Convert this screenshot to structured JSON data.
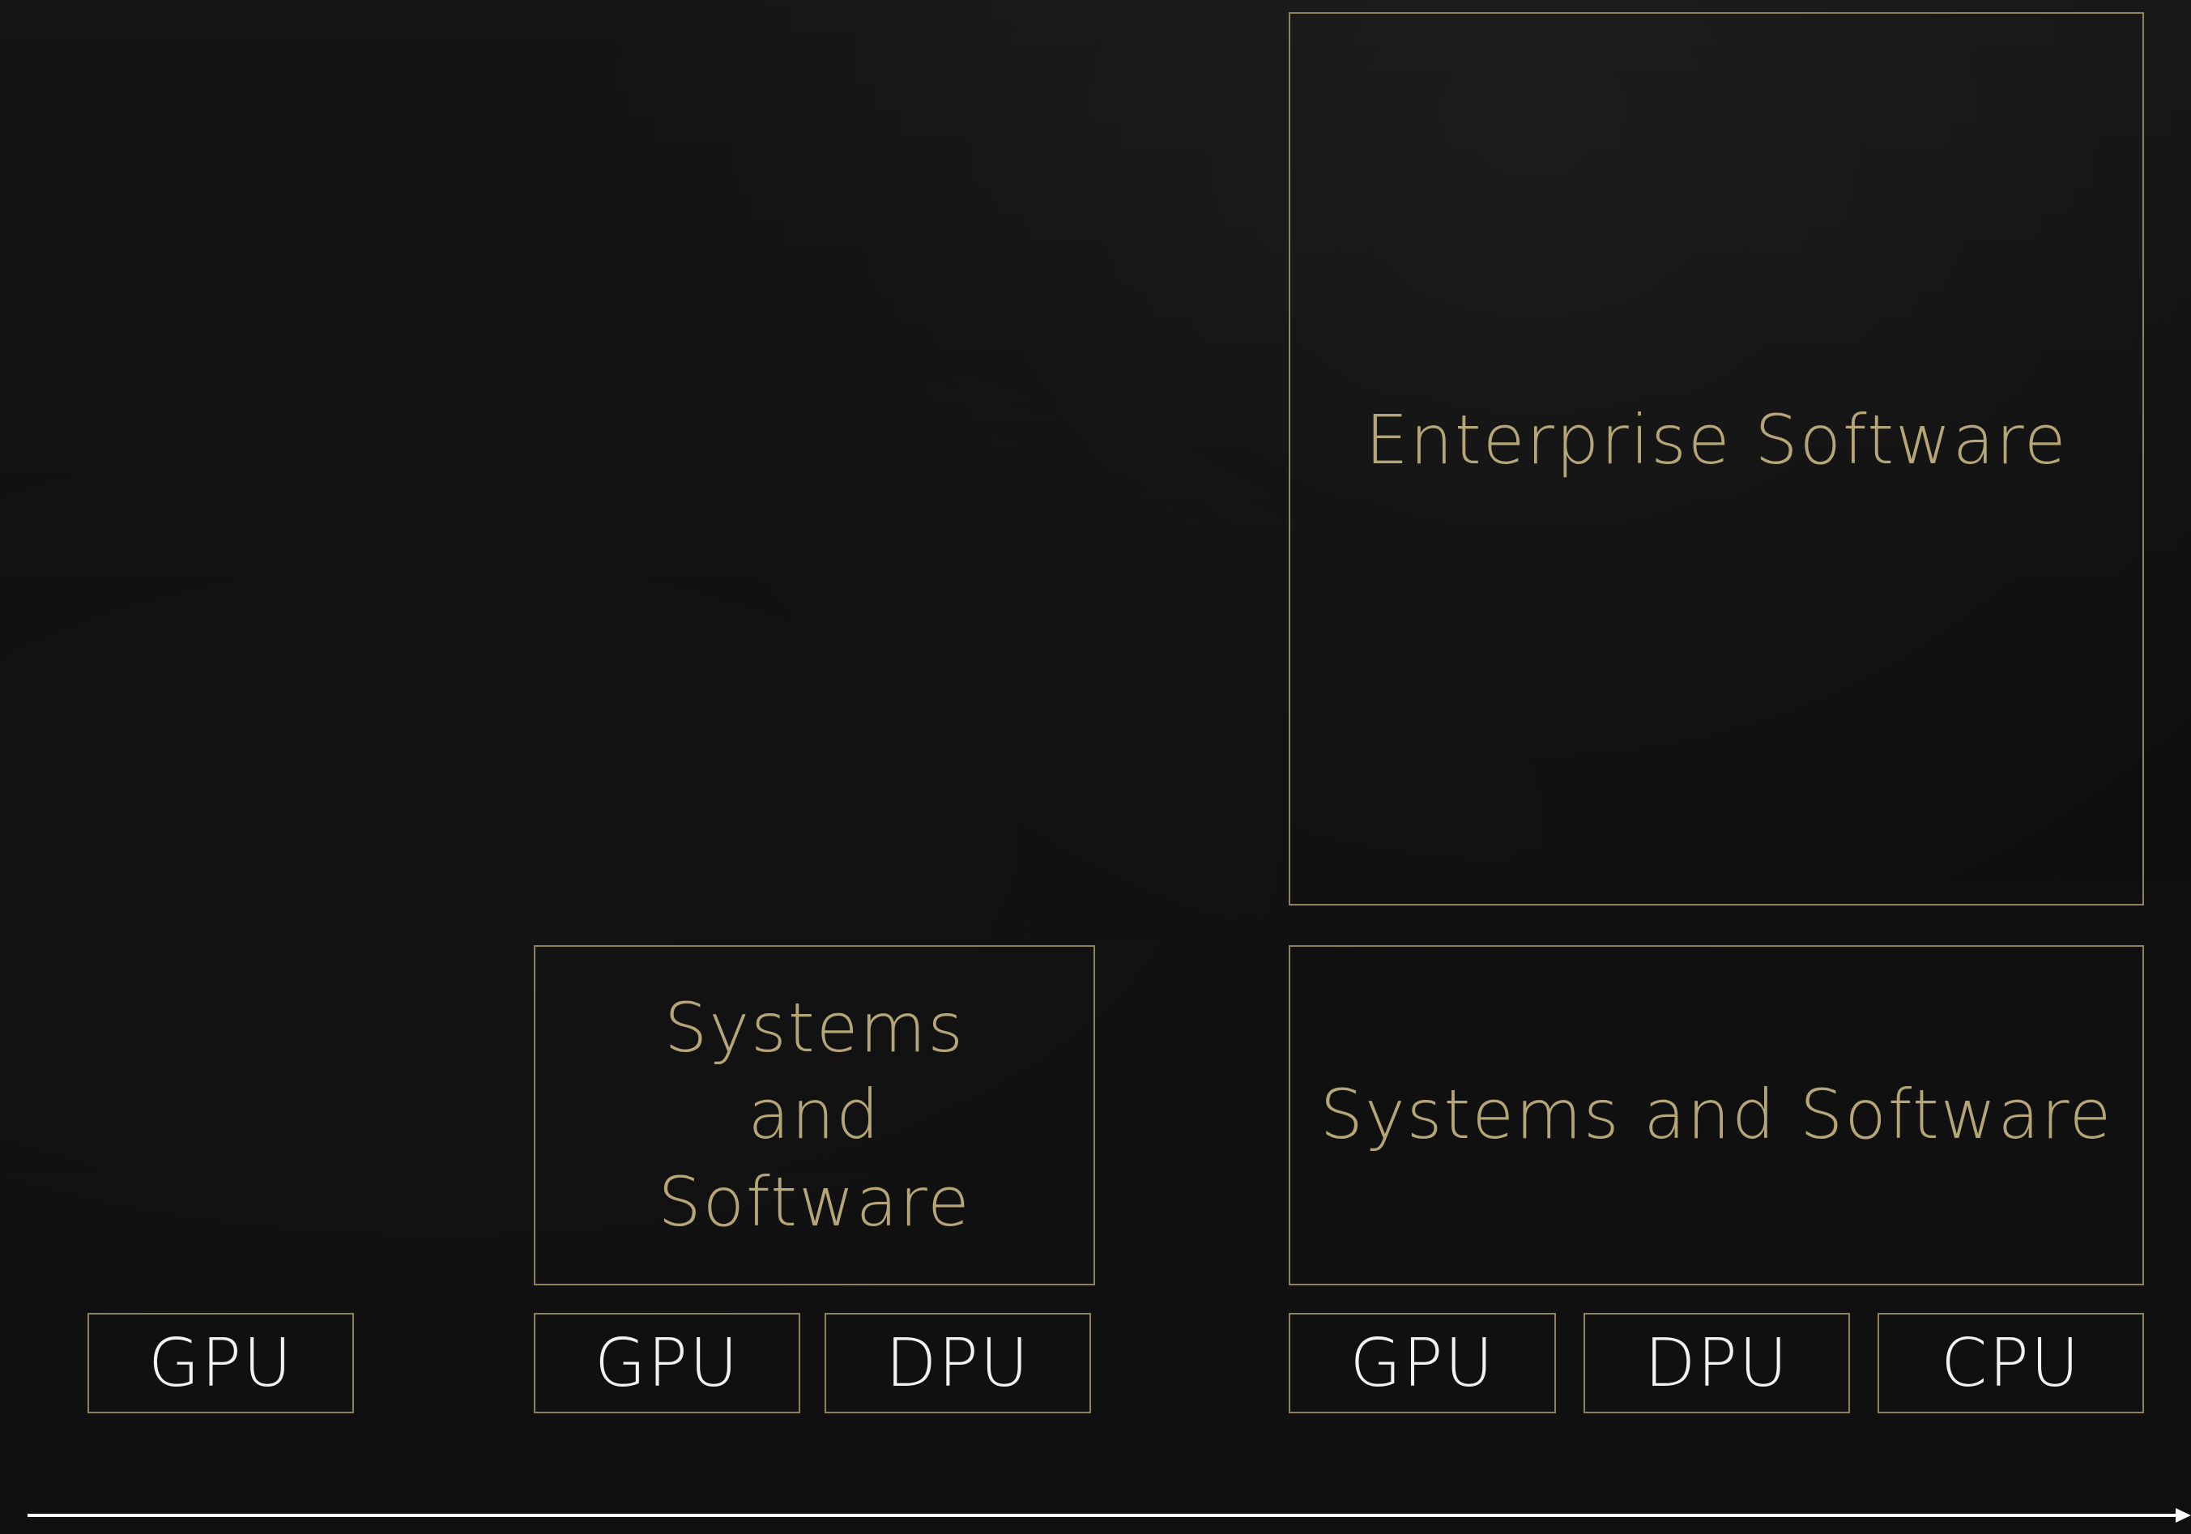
{
  "stage1": {
    "chips": {
      "gpu": "GPU"
    }
  },
  "stage2": {
    "systems_label": "Systems and Software",
    "chips": {
      "gpu": "GPU",
      "dpu": "DPU"
    }
  },
  "stage3": {
    "enterprise_label": "Enterprise Software",
    "systems_label": "Systems and Software",
    "chips": {
      "gpu": "GPU",
      "dpu": "DPU",
      "cpu": "CPU"
    }
  },
  "colors": {
    "background": "#101010",
    "box_border": "#8f815a",
    "gold_text": "#b6a577",
    "chip_text": "#f2f2f2",
    "timeline": "#ffffff"
  }
}
